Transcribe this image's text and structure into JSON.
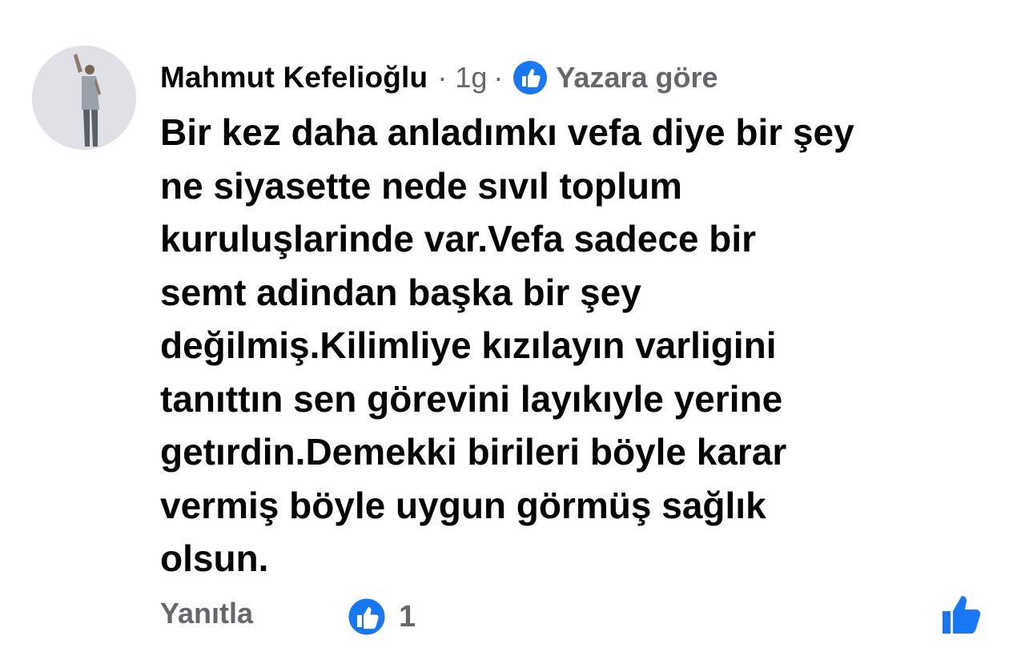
{
  "comment": {
    "author": "Mahmut Kefelioğlu",
    "separator": "·",
    "time": "1g",
    "badge_icon": "thumbs-up-circle-icon",
    "badge_label": "Yazara göre",
    "body_lines": [
      "Bir kez daha anladımkı vefa diye bir şey",
      "ne siyasette nede sıvıl toplum",
      "kuruluşlarinde var.Vefa sadece bir",
      "semt adindan başka bir şey",
      "değilmiş.Kilimliye kızılayın varligini",
      "tanıttın sen görevini layıkıyle yerine",
      "getırdin.Demekki birileri böyle karar",
      "vermiş böyle uygun görmüş sağlık",
      "olsun."
    ]
  },
  "actions": {
    "reply_label": "Yanıtla",
    "reaction_icon": "like-reaction-icon",
    "reaction_count": "1",
    "like_button_icon": "thumbs-up-icon"
  },
  "colors": {
    "text_primary": "#050505",
    "text_secondary": "#65676b",
    "facebook_blue": "#1877f2"
  }
}
